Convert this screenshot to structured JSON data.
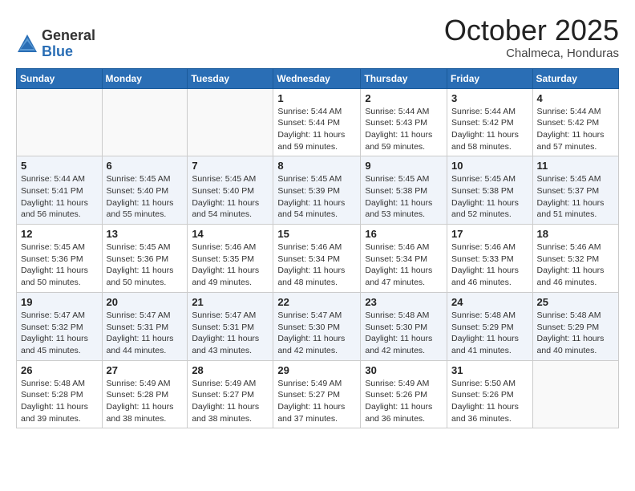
{
  "logo": {
    "general": "General",
    "blue": "Blue"
  },
  "header": {
    "month": "October 2025",
    "location": "Chalmeca, Honduras"
  },
  "weekdays": [
    "Sunday",
    "Monday",
    "Tuesday",
    "Wednesday",
    "Thursday",
    "Friday",
    "Saturday"
  ],
  "weeks": [
    [
      {
        "day": "",
        "info": ""
      },
      {
        "day": "",
        "info": ""
      },
      {
        "day": "",
        "info": ""
      },
      {
        "day": "1",
        "info": "Sunrise: 5:44 AM\nSunset: 5:44 PM\nDaylight: 11 hours\nand 59 minutes."
      },
      {
        "day": "2",
        "info": "Sunrise: 5:44 AM\nSunset: 5:43 PM\nDaylight: 11 hours\nand 59 minutes."
      },
      {
        "day": "3",
        "info": "Sunrise: 5:44 AM\nSunset: 5:42 PM\nDaylight: 11 hours\nand 58 minutes."
      },
      {
        "day": "4",
        "info": "Sunrise: 5:44 AM\nSunset: 5:42 PM\nDaylight: 11 hours\nand 57 minutes."
      }
    ],
    [
      {
        "day": "5",
        "info": "Sunrise: 5:44 AM\nSunset: 5:41 PM\nDaylight: 11 hours\nand 56 minutes."
      },
      {
        "day": "6",
        "info": "Sunrise: 5:45 AM\nSunset: 5:40 PM\nDaylight: 11 hours\nand 55 minutes."
      },
      {
        "day": "7",
        "info": "Sunrise: 5:45 AM\nSunset: 5:40 PM\nDaylight: 11 hours\nand 54 minutes."
      },
      {
        "day": "8",
        "info": "Sunrise: 5:45 AM\nSunset: 5:39 PM\nDaylight: 11 hours\nand 54 minutes."
      },
      {
        "day": "9",
        "info": "Sunrise: 5:45 AM\nSunset: 5:38 PM\nDaylight: 11 hours\nand 53 minutes."
      },
      {
        "day": "10",
        "info": "Sunrise: 5:45 AM\nSunset: 5:38 PM\nDaylight: 11 hours\nand 52 minutes."
      },
      {
        "day": "11",
        "info": "Sunrise: 5:45 AM\nSunset: 5:37 PM\nDaylight: 11 hours\nand 51 minutes."
      }
    ],
    [
      {
        "day": "12",
        "info": "Sunrise: 5:45 AM\nSunset: 5:36 PM\nDaylight: 11 hours\nand 50 minutes."
      },
      {
        "day": "13",
        "info": "Sunrise: 5:45 AM\nSunset: 5:36 PM\nDaylight: 11 hours\nand 50 minutes."
      },
      {
        "day": "14",
        "info": "Sunrise: 5:46 AM\nSunset: 5:35 PM\nDaylight: 11 hours\nand 49 minutes."
      },
      {
        "day": "15",
        "info": "Sunrise: 5:46 AM\nSunset: 5:34 PM\nDaylight: 11 hours\nand 48 minutes."
      },
      {
        "day": "16",
        "info": "Sunrise: 5:46 AM\nSunset: 5:34 PM\nDaylight: 11 hours\nand 47 minutes."
      },
      {
        "day": "17",
        "info": "Sunrise: 5:46 AM\nSunset: 5:33 PM\nDaylight: 11 hours\nand 46 minutes."
      },
      {
        "day": "18",
        "info": "Sunrise: 5:46 AM\nSunset: 5:32 PM\nDaylight: 11 hours\nand 46 minutes."
      }
    ],
    [
      {
        "day": "19",
        "info": "Sunrise: 5:47 AM\nSunset: 5:32 PM\nDaylight: 11 hours\nand 45 minutes."
      },
      {
        "day": "20",
        "info": "Sunrise: 5:47 AM\nSunset: 5:31 PM\nDaylight: 11 hours\nand 44 minutes."
      },
      {
        "day": "21",
        "info": "Sunrise: 5:47 AM\nSunset: 5:31 PM\nDaylight: 11 hours\nand 43 minutes."
      },
      {
        "day": "22",
        "info": "Sunrise: 5:47 AM\nSunset: 5:30 PM\nDaylight: 11 hours\nand 42 minutes."
      },
      {
        "day": "23",
        "info": "Sunrise: 5:48 AM\nSunset: 5:30 PM\nDaylight: 11 hours\nand 42 minutes."
      },
      {
        "day": "24",
        "info": "Sunrise: 5:48 AM\nSunset: 5:29 PM\nDaylight: 11 hours\nand 41 minutes."
      },
      {
        "day": "25",
        "info": "Sunrise: 5:48 AM\nSunset: 5:29 PM\nDaylight: 11 hours\nand 40 minutes."
      }
    ],
    [
      {
        "day": "26",
        "info": "Sunrise: 5:48 AM\nSunset: 5:28 PM\nDaylight: 11 hours\nand 39 minutes."
      },
      {
        "day": "27",
        "info": "Sunrise: 5:49 AM\nSunset: 5:28 PM\nDaylight: 11 hours\nand 38 minutes."
      },
      {
        "day": "28",
        "info": "Sunrise: 5:49 AM\nSunset: 5:27 PM\nDaylight: 11 hours\nand 38 minutes."
      },
      {
        "day": "29",
        "info": "Sunrise: 5:49 AM\nSunset: 5:27 PM\nDaylight: 11 hours\nand 37 minutes."
      },
      {
        "day": "30",
        "info": "Sunrise: 5:49 AM\nSunset: 5:26 PM\nDaylight: 11 hours\nand 36 minutes."
      },
      {
        "day": "31",
        "info": "Sunrise: 5:50 AM\nSunset: 5:26 PM\nDaylight: 11 hours\nand 36 minutes."
      },
      {
        "day": "",
        "info": ""
      }
    ]
  ]
}
